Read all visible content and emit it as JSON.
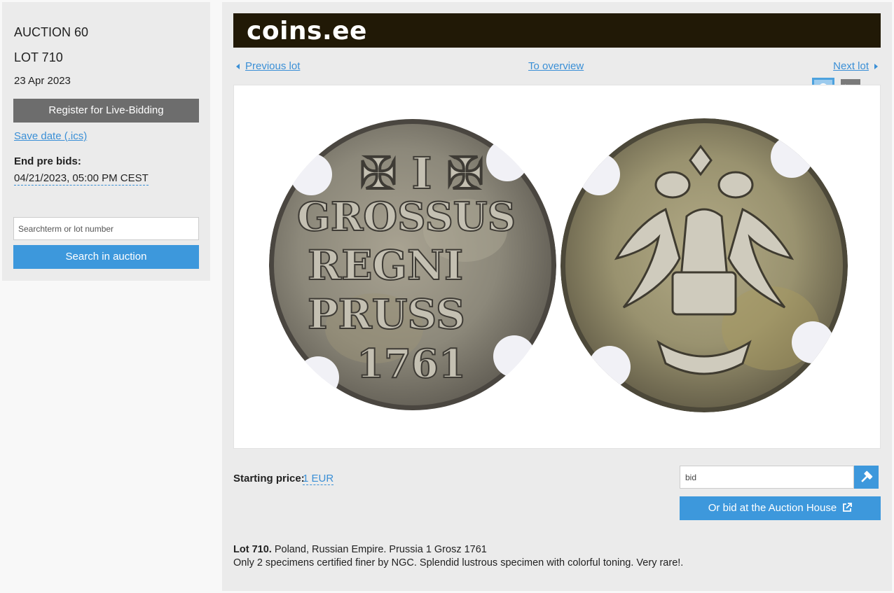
{
  "sidebar": {
    "auction": "AUCTION 60",
    "lot": "LOT 710",
    "date": "23 Apr 2023",
    "register_label": "Register for Live-Bidding",
    "save_date_label": "Save date (.ics)",
    "end_prebids_label": "End pre bids:",
    "end_prebids_value": "04/21/2023, 05:00 PM CEST",
    "search_placeholder": "Searchterm or lot number",
    "search_button": "Search in auction"
  },
  "header": {
    "logo": "coins.ee",
    "logo_bg": "#211906"
  },
  "nav": {
    "previous": "Previous lot",
    "overview": "To overview",
    "next": "Next lot"
  },
  "icons": {
    "watch": "owl-bookmark-icon",
    "mute": "bell-off-bookmark-icon",
    "bid": "gavel-icon",
    "external": "external-link-icon"
  },
  "bid": {
    "starting_price_label": "Starting price:",
    "starting_price_value": "1 EUR",
    "input_placeholder": "bid",
    "auction_house_button": "Or bid at the Auction House"
  },
  "description": {
    "lot_label": "Lot 710.",
    "title": "Poland, Russian Empire. Prussia 1 Grosz 1761",
    "text": "Only 2 specimens certified finer by NGC. Splendid lustrous specimen with colorful toning. Very rare!."
  },
  "colors": {
    "accent": "#3d98dc",
    "link": "#3a8fd6",
    "register_button": "#6d6d6d"
  }
}
